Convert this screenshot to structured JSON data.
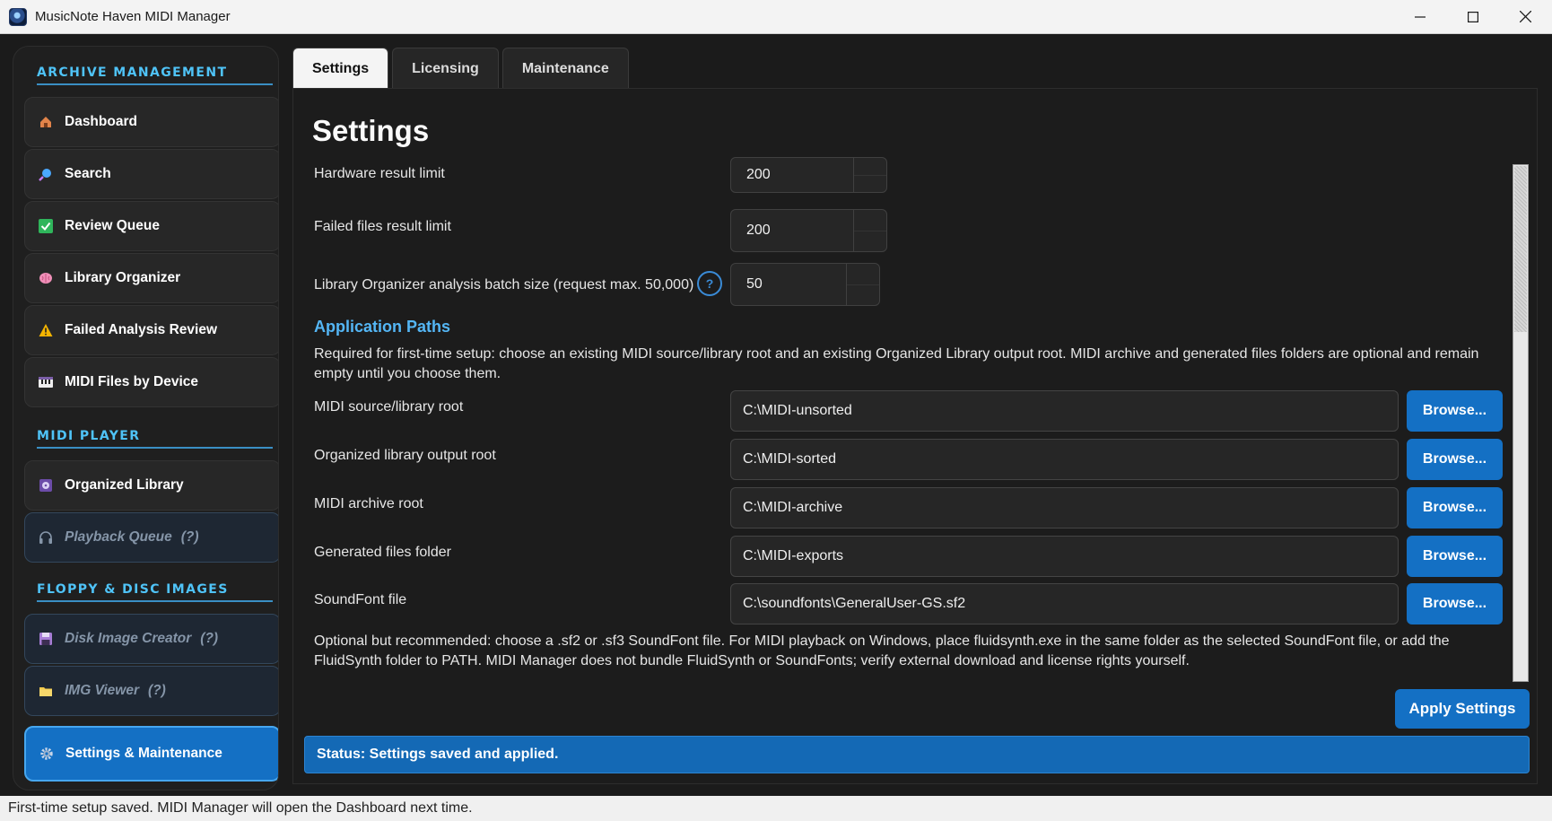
{
  "window": {
    "title": "MusicNote Haven MIDI Manager"
  },
  "sidebar": {
    "sections": [
      {
        "label": "ARCHIVE MANAGEMENT"
      },
      {
        "label": "MIDI PLAYER"
      },
      {
        "label": "FLOPPY & DISC IMAGES"
      }
    ],
    "items": [
      {
        "label": "Dashboard",
        "icon": "house-icon"
      },
      {
        "label": "Search",
        "icon": "magnifier-icon"
      },
      {
        "label": "Review Queue",
        "icon": "checkmark-icon"
      },
      {
        "label": "Library Organizer",
        "icon": "brain-icon"
      },
      {
        "label": "Failed Analysis Review",
        "icon": "warning-icon"
      },
      {
        "label": "MIDI Files by Device",
        "icon": "piano-icon"
      },
      {
        "label": "Organized Library",
        "icon": "music-disc-icon"
      },
      {
        "label": "Playback Queue",
        "icon": "headphones-icon",
        "suffix": "(?)"
      },
      {
        "label": "Disk Image Creator",
        "icon": "floppy-icon",
        "suffix": "(?)"
      },
      {
        "label": "IMG Viewer",
        "icon": "folder-icon",
        "suffix": "(?)"
      },
      {
        "label": "Settings & Maintenance",
        "icon": "gear-icon"
      }
    ]
  },
  "tabs": [
    {
      "label": "Settings",
      "active": true
    },
    {
      "label": "Licensing",
      "active": false
    },
    {
      "label": "Maintenance",
      "active": false
    }
  ],
  "main": {
    "title": "Settings",
    "limits": [
      {
        "label": "Hardware result limit",
        "value": "200"
      },
      {
        "label": "Failed files result limit",
        "value": "200"
      },
      {
        "label": "Library Organizer analysis batch size (request max. 50,000)",
        "value": "50",
        "help": "?"
      }
    ],
    "paths_heading": "Application Paths",
    "paths_intro": "Required for first-time setup: choose an existing MIDI source/library root and an existing Organized Library output root. MIDI archive and generated files folders are optional and remain empty until you choose them.",
    "paths": [
      {
        "label": "MIDI source/library root",
        "value": "C:\\MIDI-unsorted",
        "button": "Browse..."
      },
      {
        "label": "Organized library output root",
        "value": "C:\\MIDI-sorted",
        "button": "Browse..."
      },
      {
        "label": "MIDI archive root",
        "value": "C:\\MIDI-archive",
        "button": "Browse..."
      },
      {
        "label": "Generated files folder",
        "value": "C:\\MIDI-exports",
        "button": "Browse..."
      },
      {
        "label": "SoundFont file",
        "value": "C:\\soundfonts\\GeneralUser-GS.sf2",
        "button": "Browse..."
      }
    ],
    "soundfont_note": "Optional but recommended: choose a .sf2 or .sf3 SoundFont file. For MIDI playback on Windows, place fluidsynth.exe in the same folder as the selected SoundFont file, or add the FluidSynth folder to PATH. MIDI Manager does not bundle FluidSynth or SoundFonts; verify external download and license rights yourself.",
    "apply_label": "Apply Settings",
    "status": "Status: Settings saved and applied."
  },
  "footer": {
    "message": "First-time setup saved. MIDI Manager will open the Dashboard next time."
  },
  "colors": {
    "accent": "#1470c4",
    "section_heading": "#4fc3f7",
    "background": "#1c1c1c"
  }
}
